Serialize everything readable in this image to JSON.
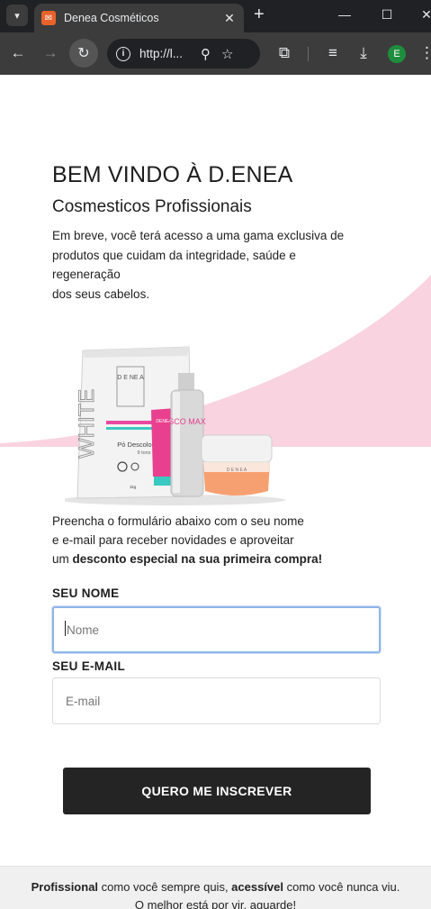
{
  "browser": {
    "tab_title": "Denea Cosméticos",
    "url": "http://l...",
    "profile_initial": "E"
  },
  "hero": {
    "title": "BEM VINDO À D.ENEA",
    "subtitle": "Cosmesticos Profissionais",
    "intro_line1": "Em breve, você terá acesso a uma gama exclusiva de",
    "intro_line2": "produtos que cuidam da integridade, saúde e",
    "intro_line3": "regeneração",
    "intro_line4": "dos seus cabelos."
  },
  "products_image": {
    "bag_brand": "D E NE A",
    "bag_side_text": "WHITE",
    "bag_product": "Pó Descolorante",
    "bag_tons": "9 tons",
    "bag_weight": "1kg",
    "tube_brand": "DENEA",
    "bottle_text": "SCO MAX",
    "jar_brand": "D E N E A"
  },
  "form": {
    "intro_line1": "Preencha o formulário abaixo com o seu nome",
    "intro_line2": "e e-mail para receber novidades e aproveitar",
    "intro_line3_prefix": "um ",
    "intro_line3_bold": "desconto especial na sua primeira compra!",
    "name_label": "SEU NOME",
    "name_placeholder": "Nome",
    "email_label": "SEU E-MAIL",
    "email_placeholder": "E-mail",
    "submit_label": "QUERO ME INSCREVER"
  },
  "footer": {
    "bold1": "Profissional",
    "text1": " como você sempre quis, ",
    "bold2": "acessível",
    "text2": " como você nunca viu.",
    "line2": "O melhor está por vir, aguarde!"
  },
  "colors": {
    "accent_pink": "#f9d3e0",
    "button_dark": "#242424",
    "focus_border": "#8fb5e8"
  }
}
